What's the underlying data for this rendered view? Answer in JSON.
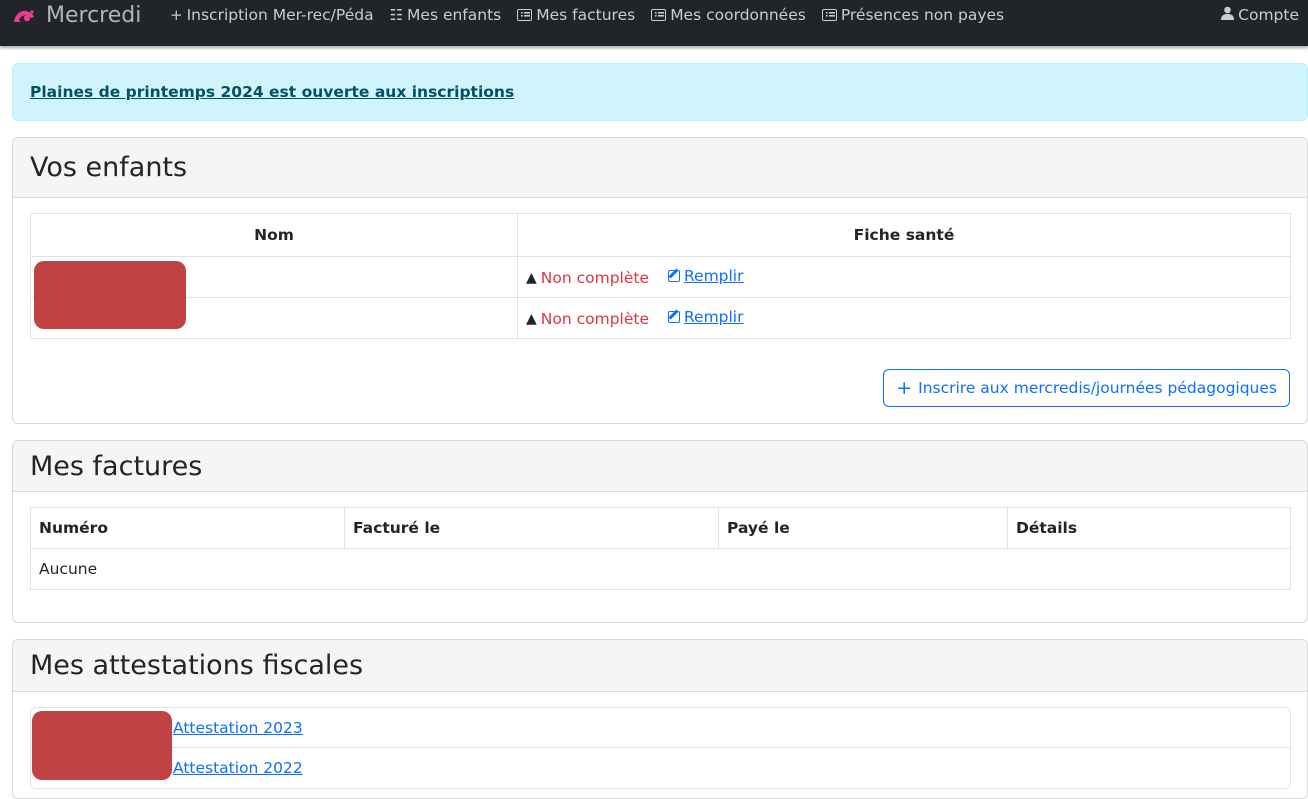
{
  "navbar": {
    "brand": "Mercredi",
    "links": [
      {
        "icon": "plus-icon",
        "label": "Inscription Mer-rec/Péda"
      },
      {
        "icon": "list-icon",
        "label": "Mes enfants"
      },
      {
        "icon": "table-list-icon",
        "label": "Mes factures"
      },
      {
        "icon": "table-list-icon",
        "label": "Mes coordonnées"
      },
      {
        "icon": "table-list-icon",
        "label": "Présences non payes"
      }
    ],
    "account": "Compte"
  },
  "alert": {
    "text": "Plaines de printemps 2024 est ouverte aux inscriptions"
  },
  "enfants": {
    "title": "Vos enfants",
    "headers": [
      "Nom",
      "Fiche santé"
    ],
    "rows": [
      {
        "status": "Non complète",
        "action": "Remplir"
      },
      {
        "status": "Non complète",
        "action": "Remplir"
      }
    ],
    "button": "Inscrire aux mercredis/journées pédagogiques"
  },
  "factures": {
    "title": "Mes factures",
    "headers": [
      "Numéro",
      "Facturé le",
      "Payé le",
      "Détails"
    ],
    "empty": "Aucune"
  },
  "attestations": {
    "title": "Mes attestations fiscales",
    "items": [
      "Attestation 2023",
      "Attestation 2022"
    ]
  },
  "colors": {
    "navbar": "#212529",
    "alert_bg": "#cff4fc",
    "link": "#0d6efd",
    "danger": "#dc3545",
    "brand_logo": "#e83e8c"
  }
}
